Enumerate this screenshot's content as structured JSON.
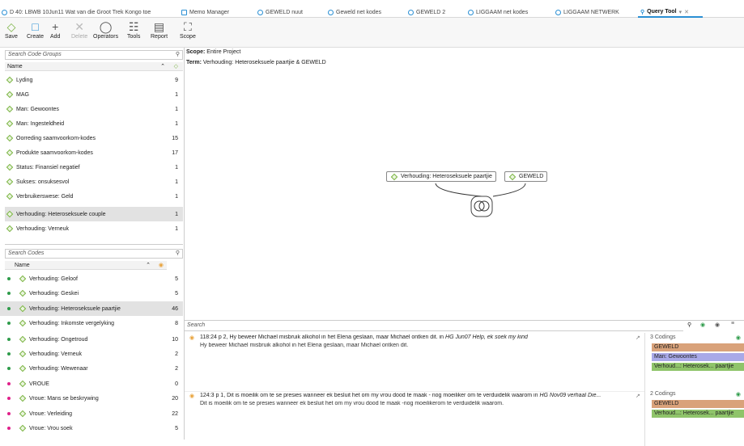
{
  "tabs": [
    {
      "label": "D 40: LBWB 10Jun11 Wat van die Groot Trek Kongo toe",
      "active": false
    },
    {
      "label": "Memo Manager",
      "active": false
    },
    {
      "label": "GEWELD nuut",
      "active": false
    },
    {
      "label": "Geweld net kodes",
      "active": false
    },
    {
      "label": "GEWELD 2",
      "active": false
    },
    {
      "label": "LIGGAAM net kodes",
      "active": false
    },
    {
      "label": "LIGGAAM NETWERK",
      "active": false
    },
    {
      "label": "Query Tool",
      "active": true
    }
  ],
  "toolbar": {
    "save": "Save",
    "create": "Create",
    "add": "Add",
    "delete": "Delete",
    "operators": "Operators",
    "tools": "Tools",
    "report": "Report",
    "scope": "Scope"
  },
  "code_groups": {
    "search_placeholder": "Search Code Groups",
    "col_name": "Name",
    "items": [
      {
        "name": "Lyding",
        "count": "9"
      },
      {
        "name": "MAG",
        "count": "1"
      },
      {
        "name": "Man: Gewoontes",
        "count": "1"
      },
      {
        "name": "Man: Ingesteldheid",
        "count": "1"
      },
      {
        "name": "Oorreding saamvoorkom-kodes",
        "count": "15"
      },
      {
        "name": "Produkte saamvoorkom-kodes",
        "count": "17"
      },
      {
        "name": "Status: Finansiel negatief",
        "count": "1"
      },
      {
        "name": "Sukses: onsuksesvol",
        "count": "1"
      },
      {
        "name": "Verbruikerswese: Geld",
        "count": "1"
      },
      {
        "name": "Verhouding: Heteroseksuele couple",
        "count": "1"
      },
      {
        "name": "Verhouding: Verneuk",
        "count": "1"
      }
    ]
  },
  "codes": {
    "search_placeholder": "Search Codes",
    "col_name": "Name",
    "items": [
      {
        "name": "Verhouding: Geloof",
        "count": "5",
        "color": "#2e9b4a"
      },
      {
        "name": "Verhouding: Geskei",
        "count": "5",
        "color": "#2e9b4a"
      },
      {
        "name": "Verhouding: Heteroseksuele paartjie",
        "count": "46",
        "color": "#2e9b4a"
      },
      {
        "name": "Verhouding: Inkomste vergelyking",
        "count": "8",
        "color": "#2e9b4a"
      },
      {
        "name": "Verhouding: Ongetroud",
        "count": "10",
        "color": "#2e9b4a"
      },
      {
        "name": "Verhouding: Verneuk",
        "count": "2",
        "color": "#2e9b4a"
      },
      {
        "name": "Verhouding: Wewenaar",
        "count": "2",
        "color": "#2e9b4a"
      },
      {
        "name": "VROUE",
        "count": "0",
        "color": "#e0208a"
      },
      {
        "name": "Vroue: Mans se beskrywing",
        "count": "20",
        "color": "#e0208a"
      },
      {
        "name": "Vroue: Verleiding",
        "count": "22",
        "color": "#e0208a"
      },
      {
        "name": "Vroue: Vrou soek",
        "count": "5",
        "color": "#e0208a"
      }
    ]
  },
  "query": {
    "scope_label": "Scope:",
    "scope_value": "Entire Project",
    "term_label": "Term:",
    "term_value": "Verhouding: Heteroseksuele paartjie & GEWELD",
    "node_left": "Verhouding: Heteroseksuele paartjie",
    "node_right": "GEWELD"
  },
  "results": {
    "search_placeholder": "Search",
    "items": [
      {
        "title": "118:24 p 2, Hy beweer Michael misbruik  alkohol in het Elena geslaan, maar Michael ontken dit.",
        "in": "in",
        "doc": "HG Jun07 Help, ek soek my kind",
        "text": "Hy beweer Michael misbruik  alkohol in het Elena geslaan,  maar Michael ontken dit.",
        "codings_label": "3 Codings",
        "codings": [
          {
            "label": "GEWELD",
            "color": "#d9a27a"
          },
          {
            "label": "Man: Gewoontes",
            "color": "#a9a9e8"
          },
          {
            "label": "Verhoud...: Heterosek... paartjie",
            "color": "#8fc46a"
          }
        ]
      },
      {
        "title": "124:3 p 1, Dit is moeilik om te se presies  wanneer ek besluit het om my  vrou dood te maak - nog moeiliker om te verduidelik waarom",
        "in": "in",
        "doc": "HG Nov09 verhaal Die...",
        "text": "Dit is moeilik om te se presies  wanneer ek besluit het om my  vrou dood te maak -nog moeilikerom te verduidelik waarom.",
        "codings_label": "2 Codings",
        "codings": [
          {
            "label": "GEWELD",
            "color": "#d9a27a"
          },
          {
            "label": "Verhoud...: Heterosek... paartjie",
            "color": "#8fc46a"
          }
        ]
      }
    ]
  }
}
